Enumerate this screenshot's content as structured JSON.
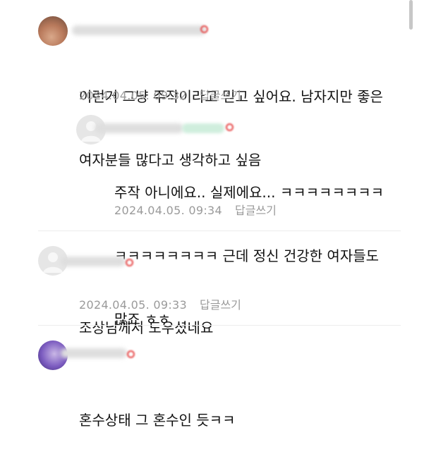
{
  "comments": [
    {
      "text_lines": [
        "이런거 그냥 주작이라고 믿고 싶어요. 남자지만 좋은",
        "여자분들 많다고 생각하고 싶음"
      ],
      "date": "2024.04.05. 09:32",
      "reply_label": "답글쓰기",
      "reply": {
        "text_lines": [
          "주작 아니에요.. 실제에요... ㅋㅋㅋㅋㅋㅋㅋㅋ",
          "ㅋㅋㅋㅋㅋㅋㅋㅋ 근데 정신 건강한 여자들도",
          "많죠 ㅎㅎ"
        ],
        "date": "2024.04.05. 09:34",
        "reply_label": "답글쓰기"
      }
    },
    {
      "text_lines": [
        "조상님께서 도우셨네요"
      ],
      "date": "2024.04.05. 09:33",
      "reply_label": "답글쓰기"
    },
    {
      "text_lines": [
        "혼수상태 그 혼수인 듯ㅋㅋ"
      ]
    }
  ]
}
